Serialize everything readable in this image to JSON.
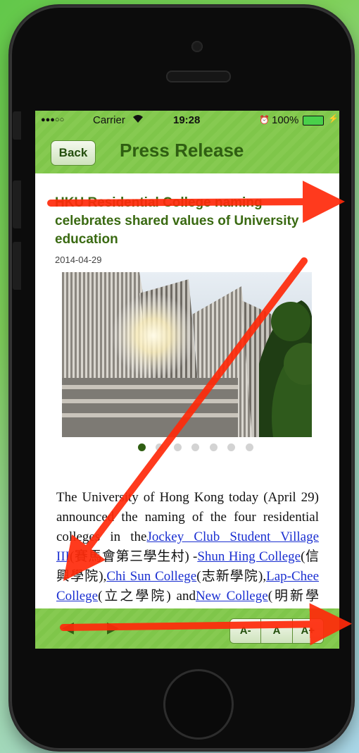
{
  "status": {
    "dots": "●●●○○",
    "carrier": "Carrier",
    "time": "19:28",
    "battery": "100%"
  },
  "nav": {
    "back_label": "Back",
    "title": "Press Release"
  },
  "article": {
    "headline": "HKU Residential College naming celebrates shared values of University education",
    "date": "2014-04-29",
    "body_parts": [
      "The University of Hong Kong today (April 29) announced the naming of the four residential colleges in the",
      "Jockey Club Student Village III",
      "(賽馬會第三學生村) -",
      "Shun Hing College",
      "(信興學院),",
      "Chi Sun College",
      "(志新學院),",
      "Lap-Chee College",
      "(立之學院) and",
      "New College",
      "(明新學院)..."
    ]
  },
  "gallery": {
    "count": 7,
    "active": 0
  },
  "toolbar": {
    "back_arrow": "◀",
    "forward_arrow": "▶",
    "font_small": "A-",
    "font_reset": "A",
    "font_large": "A+"
  },
  "colors": {
    "green": "#7fc64a",
    "dark_green": "#2f5e12",
    "link": "#1a2fd1",
    "annotation_arrow": "#ff2a0a"
  }
}
